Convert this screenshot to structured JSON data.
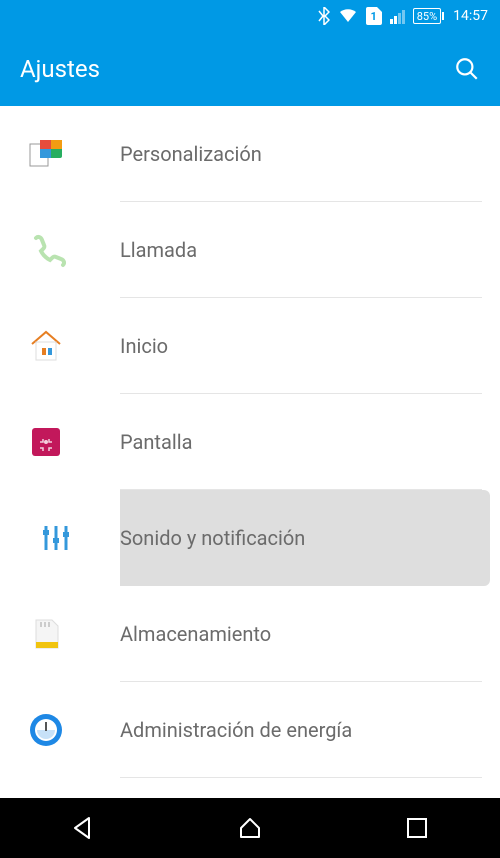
{
  "status": {
    "battery": "85%",
    "time": "14:57",
    "sim": "1"
  },
  "header": {
    "title": "Ajustes"
  },
  "items": [
    {
      "id": "personalization",
      "label": "Personalización"
    },
    {
      "id": "call",
      "label": "Llamada"
    },
    {
      "id": "home",
      "label": "Inicio"
    },
    {
      "id": "display",
      "label": "Pantalla"
    },
    {
      "id": "sound",
      "label": "Sonido y notificación",
      "selected": true
    },
    {
      "id": "storage",
      "label": "Almacenamiento"
    },
    {
      "id": "power",
      "label": "Administración de energía"
    }
  ]
}
